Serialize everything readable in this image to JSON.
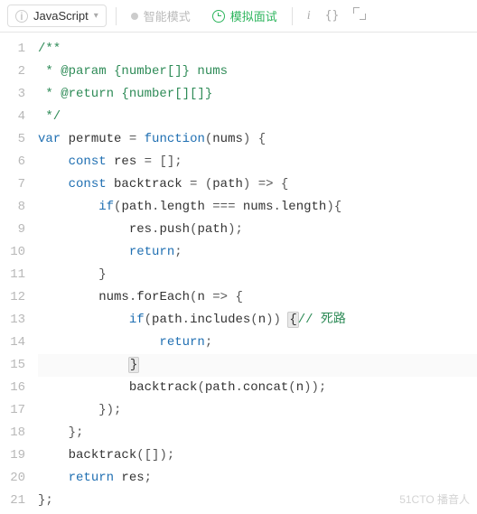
{
  "toolbar": {
    "language": "JavaScript",
    "smart_mode": "智能模式",
    "mock_interview": "模拟面试"
  },
  "editor": {
    "lines": [
      {
        "n": 1,
        "indent": 0,
        "tokens": [
          [
            "comment",
            "/**"
          ]
        ]
      },
      {
        "n": 2,
        "indent": 0,
        "tokens": [
          [
            "comment",
            " * @param {number[]} nums"
          ]
        ]
      },
      {
        "n": 3,
        "indent": 0,
        "tokens": [
          [
            "comment",
            " * @return {number[][]}"
          ]
        ]
      },
      {
        "n": 4,
        "indent": 0,
        "tokens": [
          [
            "comment",
            " */"
          ]
        ]
      },
      {
        "n": 5,
        "indent": 0,
        "tokens": [
          [
            "kw",
            "var"
          ],
          [
            "plain",
            " permute "
          ],
          [
            "op",
            "="
          ],
          [
            "plain",
            " "
          ],
          [
            "kw",
            "function"
          ],
          [
            "punc",
            "("
          ],
          [
            "plain",
            "nums"
          ],
          [
            "punc",
            ")"
          ],
          [
            "plain",
            " "
          ],
          [
            "punc",
            "{"
          ]
        ]
      },
      {
        "n": 6,
        "indent": 1,
        "tokens": [
          [
            "kw",
            "const"
          ],
          [
            "plain",
            " res "
          ],
          [
            "op",
            "="
          ],
          [
            "plain",
            " "
          ],
          [
            "punc",
            "["
          ],
          [
            "punc",
            "]"
          ],
          [
            "punc",
            ";"
          ]
        ]
      },
      {
        "n": 7,
        "indent": 1,
        "tokens": [
          [
            "kw",
            "const"
          ],
          [
            "plain",
            " backtrack "
          ],
          [
            "op",
            "="
          ],
          [
            "plain",
            " "
          ],
          [
            "punc",
            "("
          ],
          [
            "plain",
            "path"
          ],
          [
            "punc",
            ")"
          ],
          [
            "plain",
            " "
          ],
          [
            "op",
            "=>"
          ],
          [
            "plain",
            " "
          ],
          [
            "punc",
            "{"
          ]
        ]
      },
      {
        "n": 8,
        "indent": 2,
        "tokens": [
          [
            "kw",
            "if"
          ],
          [
            "punc",
            "("
          ],
          [
            "plain",
            "path"
          ],
          [
            "punc",
            "."
          ],
          [
            "plain",
            "length "
          ],
          [
            "op",
            "==="
          ],
          [
            "plain",
            " nums"
          ],
          [
            "punc",
            "."
          ],
          [
            "plain",
            "length"
          ],
          [
            "punc",
            ")"
          ],
          [
            "punc",
            "{"
          ]
        ]
      },
      {
        "n": 9,
        "indent": 3,
        "tokens": [
          [
            "plain",
            "res"
          ],
          [
            "punc",
            "."
          ],
          [
            "fn",
            "push"
          ],
          [
            "punc",
            "("
          ],
          [
            "plain",
            "path"
          ],
          [
            "punc",
            ")"
          ],
          [
            "punc",
            ";"
          ]
        ]
      },
      {
        "n": 10,
        "indent": 3,
        "tokens": [
          [
            "kw",
            "return"
          ],
          [
            "punc",
            ";"
          ]
        ]
      },
      {
        "n": 11,
        "indent": 2,
        "tokens": [
          [
            "punc",
            "}"
          ]
        ]
      },
      {
        "n": 12,
        "indent": 2,
        "tokens": [
          [
            "plain",
            "nums"
          ],
          [
            "punc",
            "."
          ],
          [
            "fn",
            "forEach"
          ],
          [
            "punc",
            "("
          ],
          [
            "plain",
            "n "
          ],
          [
            "op",
            "=>"
          ],
          [
            "plain",
            " "
          ],
          [
            "punc",
            "{"
          ]
        ]
      },
      {
        "n": 13,
        "indent": 3,
        "tokens": [
          [
            "kw",
            "if"
          ],
          [
            "punc",
            "("
          ],
          [
            "plain",
            "path"
          ],
          [
            "punc",
            "."
          ],
          [
            "fn",
            "includes"
          ],
          [
            "punc",
            "("
          ],
          [
            "plain",
            "n"
          ],
          [
            "punc",
            ")"
          ],
          [
            "punc",
            ")"
          ],
          [
            "plain",
            " "
          ],
          [
            "hl",
            "{"
          ],
          [
            "comment",
            "// 死路"
          ]
        ]
      },
      {
        "n": 14,
        "indent": 4,
        "tokens": [
          [
            "kw",
            "return"
          ],
          [
            "punc",
            ";"
          ]
        ]
      },
      {
        "n": 15,
        "indent": 3,
        "cursor": true,
        "tokens": [
          [
            "hl",
            "}"
          ]
        ]
      },
      {
        "n": 16,
        "indent": 3,
        "tokens": [
          [
            "fn",
            "backtrack"
          ],
          [
            "punc",
            "("
          ],
          [
            "plain",
            "path"
          ],
          [
            "punc",
            "."
          ],
          [
            "fn",
            "concat"
          ],
          [
            "punc",
            "("
          ],
          [
            "plain",
            "n"
          ],
          [
            "punc",
            ")"
          ],
          [
            "punc",
            ")"
          ],
          [
            "punc",
            ";"
          ]
        ]
      },
      {
        "n": 17,
        "indent": 2,
        "tokens": [
          [
            "punc",
            "}"
          ],
          [
            "punc",
            ")"
          ],
          [
            "punc",
            ";"
          ]
        ]
      },
      {
        "n": 18,
        "indent": 1,
        "tokens": [
          [
            "punc",
            "}"
          ],
          [
            "punc",
            ";"
          ]
        ]
      },
      {
        "n": 19,
        "indent": 1,
        "tokens": [
          [
            "fn",
            "backtrack"
          ],
          [
            "punc",
            "("
          ],
          [
            "punc",
            "["
          ],
          [
            "punc",
            "]"
          ],
          [
            "punc",
            ")"
          ],
          [
            "punc",
            ";"
          ]
        ]
      },
      {
        "n": 20,
        "indent": 1,
        "tokens": [
          [
            "kw",
            "return"
          ],
          [
            "plain",
            " res"
          ],
          [
            "punc",
            ";"
          ]
        ]
      },
      {
        "n": 21,
        "indent": 0,
        "tokens": [
          [
            "punc",
            "}"
          ],
          [
            "punc",
            ";"
          ]
        ]
      }
    ]
  },
  "watermark": "51CTO 播音人"
}
